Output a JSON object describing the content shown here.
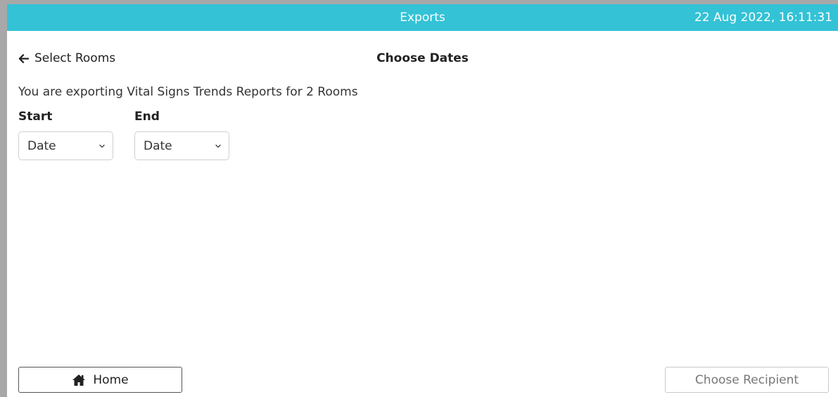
{
  "header": {
    "title": "Exports",
    "datetime": "22 Aug 2022, 16:11:31",
    "background_color": "#33c2d6"
  },
  "nav": {
    "back_label": "Select Rooms",
    "back_icon": "arrow-left-icon"
  },
  "page": {
    "heading": "Choose Dates",
    "description": "You are exporting Vital Signs Trends Reports for 2 Rooms"
  },
  "dates": {
    "start_label": "Start",
    "start_value": "Date",
    "end_label": "End",
    "end_value": "Date",
    "dropdown_icon": "chevron-down-icon"
  },
  "footer": {
    "home_label": "Home",
    "home_icon": "home-icon",
    "next_label": "Choose Recipient"
  }
}
